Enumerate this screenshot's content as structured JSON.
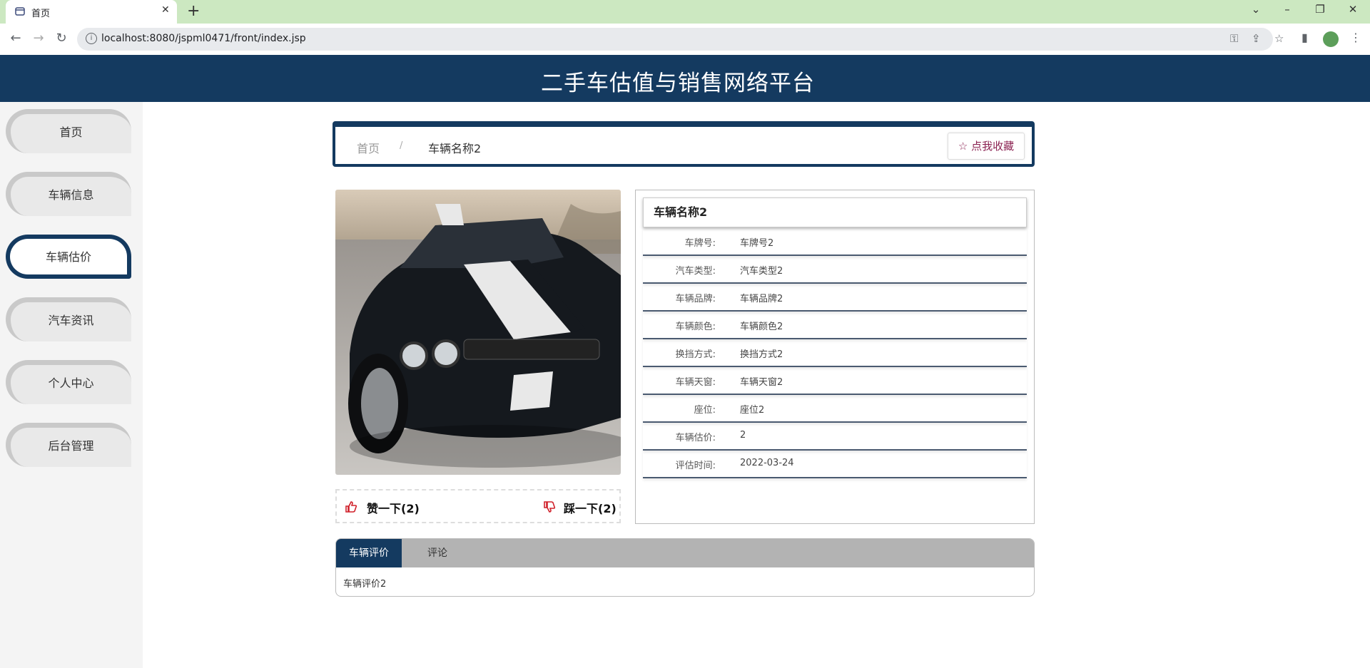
{
  "browser": {
    "tab_title": "首页",
    "url": "localhost:8080/jspml0471/front/index.jsp"
  },
  "header": {
    "title": "二手车估值与销售网络平台"
  },
  "sidebar": {
    "items": [
      {
        "label": "首页",
        "active": false
      },
      {
        "label": "车辆信息",
        "active": false
      },
      {
        "label": "车辆估价",
        "active": true
      },
      {
        "label": "汽车资讯",
        "active": false
      },
      {
        "label": "个人中心",
        "active": false
      },
      {
        "label": "后台管理",
        "active": false
      }
    ]
  },
  "breadcrumb": {
    "home": "首页",
    "separator": "/",
    "current": "车辆名称2",
    "favorite": "☆ 点我收藏"
  },
  "likes": {
    "up": "赞一下(2)",
    "down": "踩一下(2)"
  },
  "detail": {
    "title": "车辆名称2",
    "rows": [
      {
        "label": "车牌号:",
        "value": "车牌号2"
      },
      {
        "label": "汽车类型:",
        "value": "汽车类型2"
      },
      {
        "label": "车辆品牌:",
        "value": "车辆品牌2"
      },
      {
        "label": "车辆颜色:",
        "value": "车辆颜色2"
      },
      {
        "label": "换挡方式:",
        "value": "换挡方式2"
      },
      {
        "label": "车辆天窗:",
        "value": "车辆天窗2"
      },
      {
        "label": "座位:",
        "value": "座位2"
      },
      {
        "label": "车辆估价:",
        "value": "2"
      },
      {
        "label": "评估时间:",
        "value": "2022-03-24"
      }
    ]
  },
  "tabs": {
    "items": [
      {
        "label": "车辆评价",
        "active": true
      },
      {
        "label": "评论",
        "active": false
      }
    ],
    "content": "车辆评价2"
  },
  "colors": {
    "primary": "#143a60",
    "tabbar": "#cce8c1"
  }
}
